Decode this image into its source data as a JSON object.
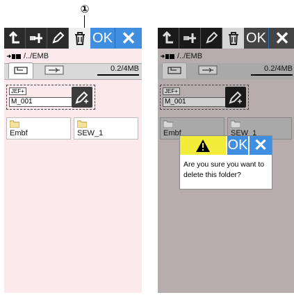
{
  "callout": {
    "number": "①"
  },
  "screens": [
    {
      "toolbar": {
        "ok": "OK",
        "cancel": "✕"
      },
      "path": "/../EMB",
      "memory": "0.2/4MB",
      "format_tag": "JEF+",
      "file_name": "M_001",
      "folders": [
        "Embf",
        "SEW_1"
      ]
    },
    {
      "toolbar": {
        "ok": "OK",
        "cancel": "✕"
      },
      "path": "/../EMB",
      "memory": "0.2/4MB",
      "format_tag": "JEF+",
      "file_name": "M_001",
      "folders": [
        "Embf",
        "SEW_1"
      ]
    }
  ],
  "dialog": {
    "ok": "OK",
    "cancel": "✕",
    "message": "Are you sure you want to delete this folder?"
  }
}
